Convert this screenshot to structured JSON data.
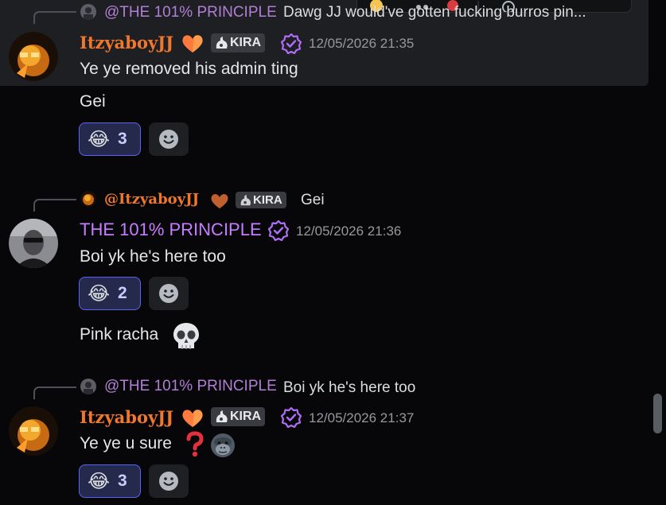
{
  "messages": [
    {
      "reply": {
        "author": "@THE 101% PRINCIPLE",
        "text": "Dawg JJ would've gotten fucking burros pin..."
      },
      "author": "ItzyaboyJJ",
      "tag": "KIRA",
      "timestamp": "12/05/2026 21:35",
      "lines": [
        "Ye ye removed his admin ting",
        "Gei"
      ],
      "reaction": {
        "emoji": "😂",
        "count": "3"
      }
    },
    {
      "reply": {
        "author": "@ItzyaboyJJ",
        "tag": "KIRA",
        "text": "Gei"
      },
      "author": "THE 101% PRINCIPLE",
      "timestamp": "12/05/2026 21:36",
      "lines": [
        "Boi yk he's here too",
        "Pink racha"
      ],
      "reaction": {
        "emoji": "😂",
        "count": "2"
      }
    },
    {
      "reply": {
        "author": "@THE 101% PRINCIPLE",
        "text": "Boi yk he's here too"
      },
      "author": "ItzyaboyJJ",
      "tag": "KIRA",
      "timestamp": "12/05/2026 21:37",
      "lines": [
        "Ye ye u sure"
      ],
      "reaction": {
        "emoji": "😂",
        "count": "3"
      }
    }
  ],
  "colors": {
    "background": "#070709",
    "hover_background": "#1e1f22",
    "jj_name": "#f0772c",
    "principle_name": "#c77dff",
    "reaction_border": "#5865f2"
  },
  "icons": [
    "heart-icon",
    "fire-logo-icon",
    "verified-badge-icon",
    "skull-icon",
    "question-mark-icon",
    "gorilla-icon",
    "add-reaction-icon"
  ]
}
